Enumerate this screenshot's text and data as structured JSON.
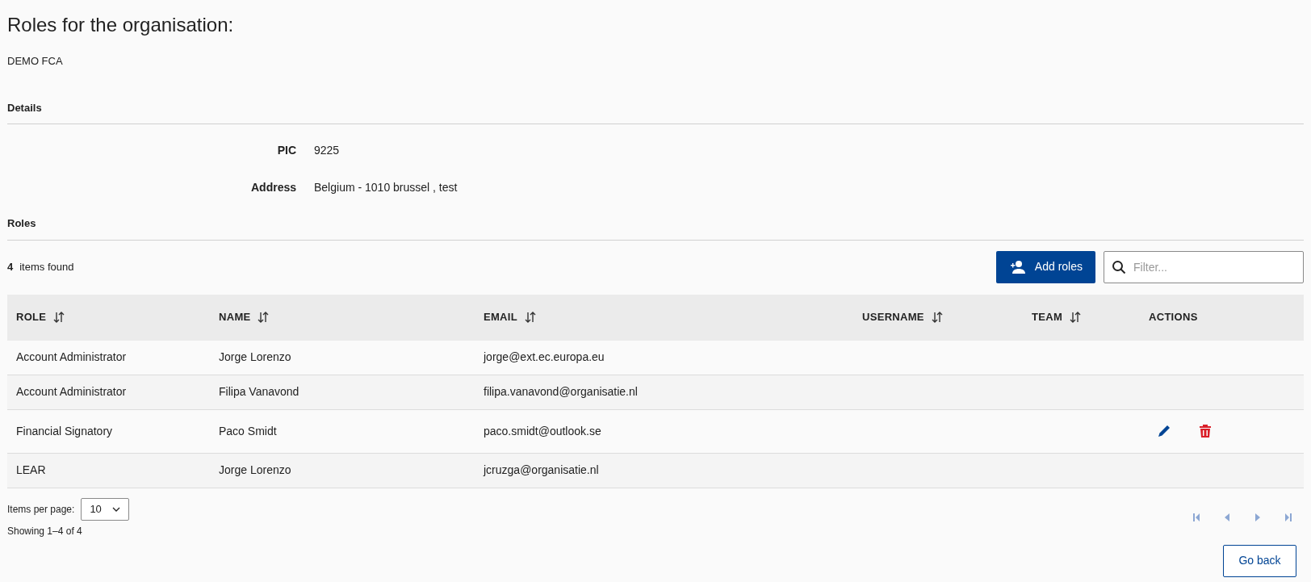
{
  "page": {
    "title": "Roles for the organisation:",
    "organisation": "DEMO FCA"
  },
  "details": {
    "heading": "Details",
    "fields": [
      {
        "label": "PIC",
        "value": "9225"
      },
      {
        "label": "Address",
        "value": "Belgium - 1010 brussel , test"
      }
    ]
  },
  "roles": {
    "heading": "Roles",
    "count": "4",
    "count_label": "items found",
    "add_button": "Add roles",
    "filter": {
      "placeholder": "Filter..."
    },
    "columns": [
      {
        "label": "ROLE",
        "sortable": true
      },
      {
        "label": "NAME",
        "sortable": true
      },
      {
        "label": "EMAIL",
        "sortable": true
      },
      {
        "label": "USERNAME",
        "sortable": true
      },
      {
        "label": "TEAM",
        "sortable": true
      },
      {
        "label": "ACTIONS",
        "sortable": false
      }
    ],
    "rows": [
      {
        "role": "Account Administrator",
        "name": "Jorge Lorenzo",
        "email": "jorge@ext.ec.europa.eu",
        "actions": false
      },
      {
        "role": "Account Administrator",
        "name": "Filipa Vanavond",
        "email": "filipa.vanavond@organisatie.nl",
        "actions": false
      },
      {
        "role": "Financial Signatory",
        "name": "Paco Smidt",
        "email": "paco.smidt@outlook.se",
        "actions": true
      },
      {
        "role": "LEAR",
        "name": "Jorge Lorenzo",
        "email": "jcruzga@organisatie.nl",
        "actions": false
      }
    ]
  },
  "paginator": {
    "items_per_page_label": "Items per page:",
    "page_size": "10",
    "range": "Showing 1–4 of 4",
    "disabled": true
  },
  "go_back": "Go back"
}
